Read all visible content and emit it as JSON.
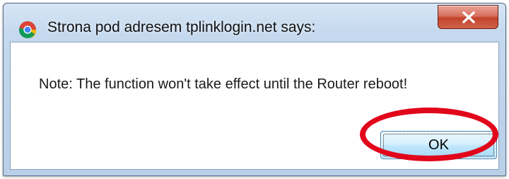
{
  "dialog": {
    "title": "Strona pod adresem tplinklogin.net says:",
    "app_icon": "chrome-icon",
    "close_icon": "close-icon",
    "message": "Note: The function won't take effect until the Router reboot!",
    "ok_label": "OK"
  },
  "annotation": {
    "highlight_color": "#e1061b"
  },
  "colors": {
    "titlebar": "#c4d8ee",
    "close_button": "#c2432b",
    "ok_button": "#bee6fd"
  }
}
